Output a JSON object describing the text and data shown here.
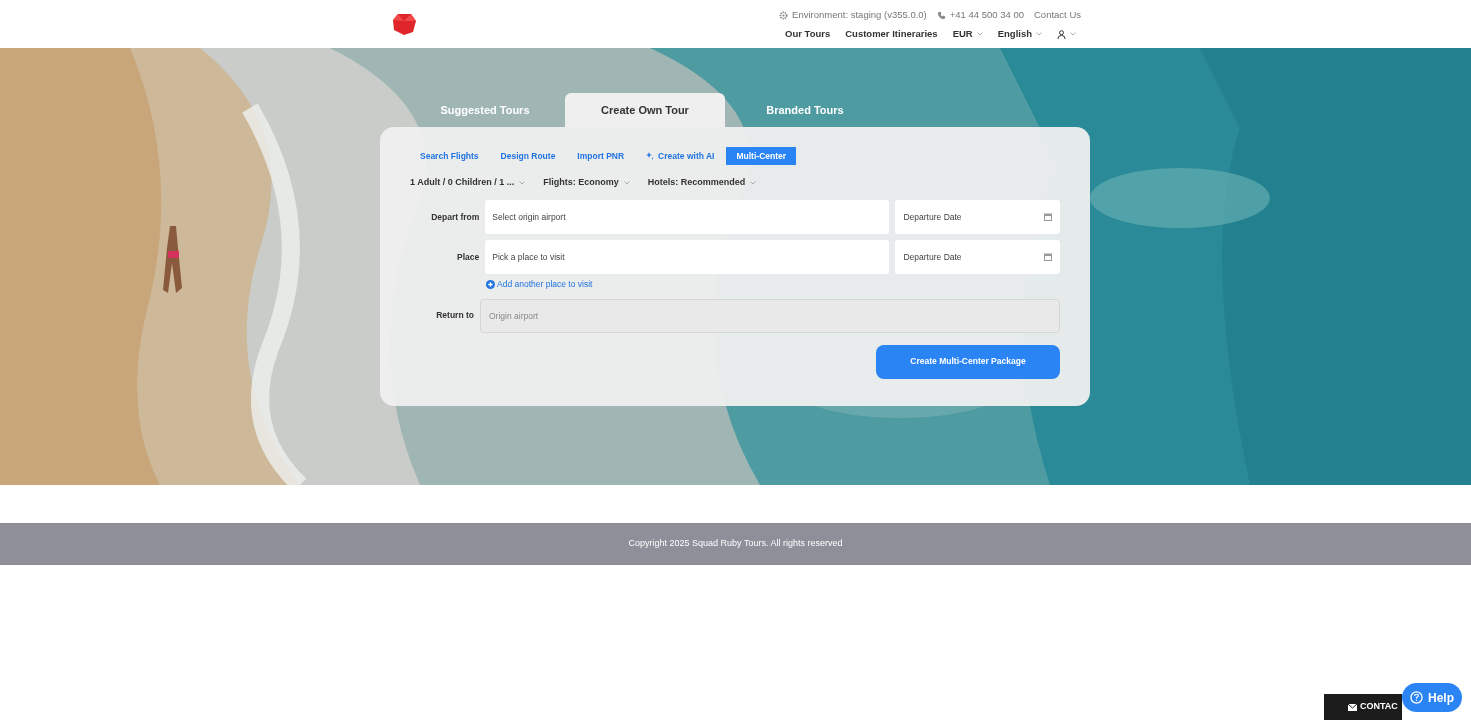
{
  "header": {
    "environment": "Environment: staging (v355.0.0)",
    "phone": "+41 44 500 34 00",
    "contact_link": "Contact Us",
    "nav": [
      {
        "label": "Our Tours",
        "kind": "link"
      },
      {
        "label": "Customer Itineraries",
        "kind": "link"
      },
      {
        "label": "EUR",
        "kind": "dropdown"
      },
      {
        "label": "English",
        "kind": "dropdown"
      },
      {
        "kind": "user"
      }
    ]
  },
  "tour_tabs": [
    {
      "label": "Suggested Tours",
      "selected": false
    },
    {
      "label": "Create Own Tour",
      "selected": true
    },
    {
      "label": "Branded Tours",
      "selected": false
    }
  ],
  "mode_tabs": [
    {
      "label": "Search Flights",
      "selected": false,
      "kind": "plain"
    },
    {
      "label": "Design Route",
      "selected": false,
      "kind": "plain"
    },
    {
      "label": "Import PNR",
      "selected": false,
      "kind": "plain"
    },
    {
      "label": "Create with AI",
      "selected": false,
      "kind": "ai"
    },
    {
      "label": "Multi-Center",
      "selected": true,
      "kind": "plain"
    }
  ],
  "options": [
    "1 Adult / 0 Children / 1 ...",
    "Flights: Economy",
    "Hotels: Recommended"
  ],
  "rows": [
    {
      "label": "Depart from",
      "placeholder": "Select origin airport",
      "date_placeholder": "Departure Date"
    },
    {
      "label": "Place",
      "placeholder": "Pick a place to visit",
      "date_placeholder": "Departure Date"
    }
  ],
  "add_place": "Add another place to visit",
  "return": {
    "label": "Return to",
    "placeholder": "Origin airport",
    "disabled": true
  },
  "submit": "Create Multi-Center Package",
  "footer": "Copyright 2025 Squad Ruby Tours. All rights reserved",
  "contact_tab": "CONTAC",
  "help": "Help"
}
